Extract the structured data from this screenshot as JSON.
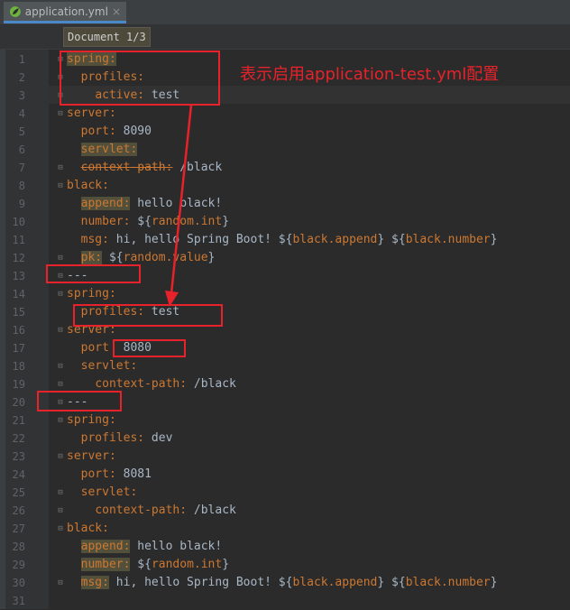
{
  "tab": {
    "filename": "application.yml",
    "close": "×"
  },
  "breadcrumb": "Document 1/3",
  "annotation": "表示启用application-test.yml配置",
  "lines": [
    {
      "n": "1",
      "html": "<span class='kw'>spring:</span>"
    },
    {
      "n": "2",
      "html": "  <span class='k'>profiles:</span>"
    },
    {
      "n": "3",
      "html": "    <span class='k'>active:</span> test"
    },
    {
      "n": "4",
      "html": "<span class='k'>server:</span>"
    },
    {
      "n": "5",
      "html": "  <span class='k'>port:</span> 8090"
    },
    {
      "n": "6",
      "html": "  <span class='kw'>servlet:</span>"
    },
    {
      "n": "7",
      "html": "  <span class='strike'>context-path:</span> /black"
    },
    {
      "n": "8",
      "html": "<span class='k'>black:</span>"
    },
    {
      "n": "9",
      "html": "  <span class='kw'>append:</span> hello black!"
    },
    {
      "n": "10",
      "html": "  <span class='k'>number:</span> ${<span class='ph'>random.int</span>}"
    },
    {
      "n": "11",
      "html": "  <span class='k'>msg:</span> hi, hello Spring Boot! ${<span class='ph'>black.append</span>} ${<span class='ph'>black.number</span>}"
    },
    {
      "n": "12",
      "html": "  <span class='kw'>pk:</span> ${<span class='ph'>random.value</span>}"
    },
    {
      "n": "13",
      "html": "---"
    },
    {
      "n": "14",
      "html": "<span class='k'>spring:</span>"
    },
    {
      "n": "15",
      "html": "  <span class='k'>profiles:</span> test"
    },
    {
      "n": "16",
      "html": "<span class='k'>server:</span>"
    },
    {
      "n": "17",
      "html": "  <span class='k'>port</span>  8080"
    },
    {
      "n": "18",
      "html": "  <span class='k'>servlet:</span>"
    },
    {
      "n": "19",
      "html": "    <span class='k'>context-path:</span> /black"
    },
    {
      "n": "20",
      "html": "---"
    },
    {
      "n": "21",
      "html": "<span class='k'>spring:</span>"
    },
    {
      "n": "22",
      "html": "  <span class='k'>profiles:</span> dev"
    },
    {
      "n": "23",
      "html": "<span class='k'>server:</span>"
    },
    {
      "n": "24",
      "html": "  <span class='k'>port:</span> 8081"
    },
    {
      "n": "25",
      "html": "  <span class='k'>servlet:</span>"
    },
    {
      "n": "26",
      "html": "    <span class='k'>context-path:</span> /black"
    },
    {
      "n": "27",
      "html": "<span class='k'>black:</span>"
    },
    {
      "n": "28",
      "html": "  <span class='kw'>append:</span> hello black!"
    },
    {
      "n": "29",
      "html": "  <span class='kw'>number:</span> ${<span class='ph'>random.int</span>}"
    },
    {
      "n": "30",
      "html": "  <span class='kw'>msg:</span> hi, hello Spring Boot! ${<span class='ph'>black.append</span>} ${<span class='ph'>black.number</span>}"
    },
    {
      "n": "31",
      "html": ""
    }
  ],
  "colors": {
    "annotation": "#e8222a",
    "key": "#cc7832",
    "text": "#a9b7c6",
    "background": "#2b2b2b"
  }
}
